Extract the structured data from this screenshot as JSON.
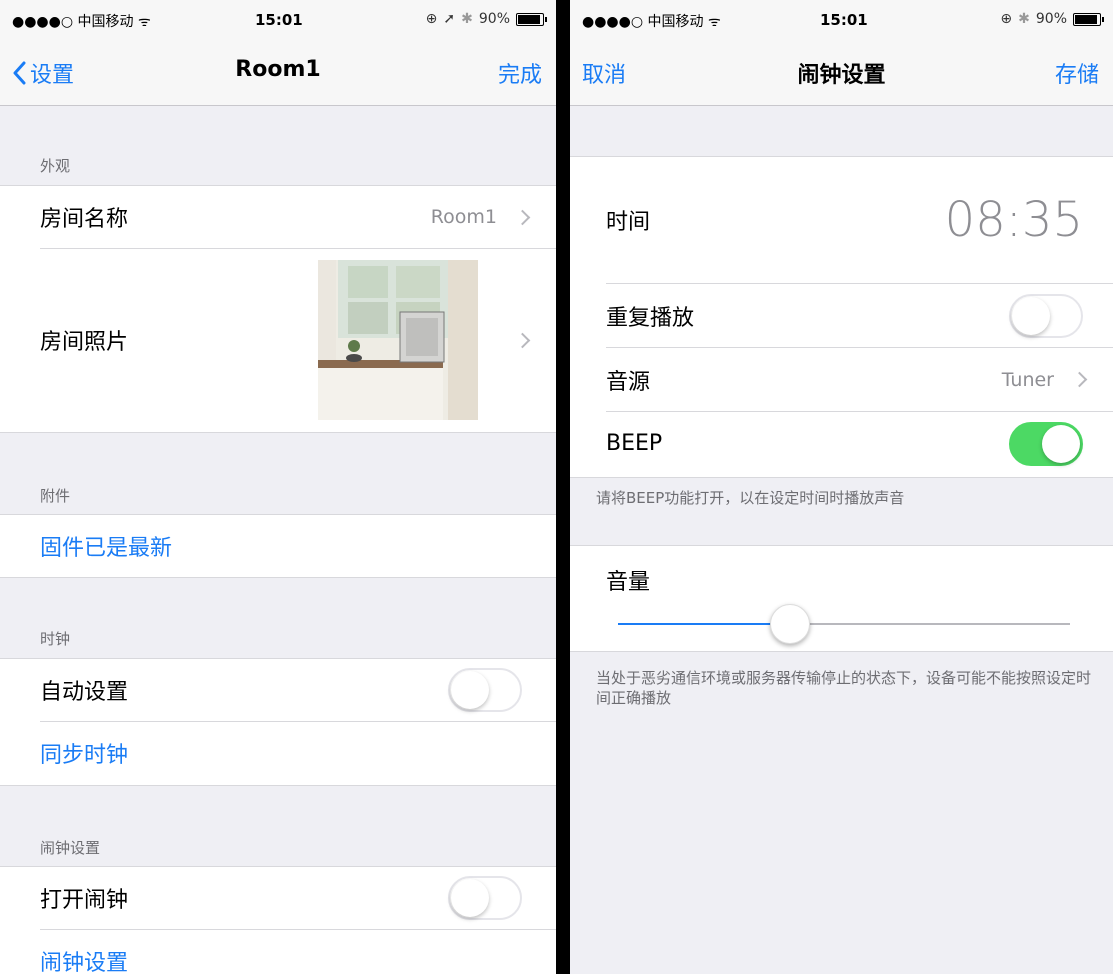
{
  "left": {
    "status": {
      "carrier": "●●●●○ 中国移动 ",
      "time": "15:01",
      "battery": "90%"
    },
    "nav": {
      "back_label": "设置",
      "title": "Room1",
      "done_label": "完成"
    },
    "appearance": {
      "header": "外观",
      "room_name_label": "房间名称",
      "room_name_value": "Room1",
      "room_photo_label": "房间照片"
    },
    "accessories": {
      "header": "附件",
      "firmware_label": "固件已是最新"
    },
    "clock": {
      "header": "时钟",
      "auto_set_label": "自动设置",
      "auto_set_on": false,
      "sync_label": "同步时钟"
    },
    "alarm": {
      "header": "闹钟设置",
      "open_alarm_label": "打开闹钟",
      "open_alarm_on": false,
      "alarm_settings_label": "闹钟设置"
    }
  },
  "right": {
    "status": {
      "carrier": "●●●●○ 中国移动 ",
      "time": "15:01",
      "battery": "90%"
    },
    "nav": {
      "cancel_label": "取消",
      "title": "闹钟设置",
      "save_label": "存储"
    },
    "time_label": "时间",
    "time_value": "08:35",
    "repeat_label": "重复播放",
    "repeat_on": false,
    "source_label": "音源",
    "source_value": "Tuner",
    "beep_label": "BEEP",
    "beep_on": true,
    "beep_note": "请将BEEP功能打开，以在设定时间时播放声音",
    "volume_label": "音量",
    "volume_level": 0.37,
    "footer_note": "当处于恶劣通信环境或服务器传输停止的状态下，设备可能不能按照设定时间正确播放"
  },
  "colors": {
    "accent": "#1a7cf5",
    "toggle_on": "#4cd964",
    "background": "#efeff4"
  }
}
